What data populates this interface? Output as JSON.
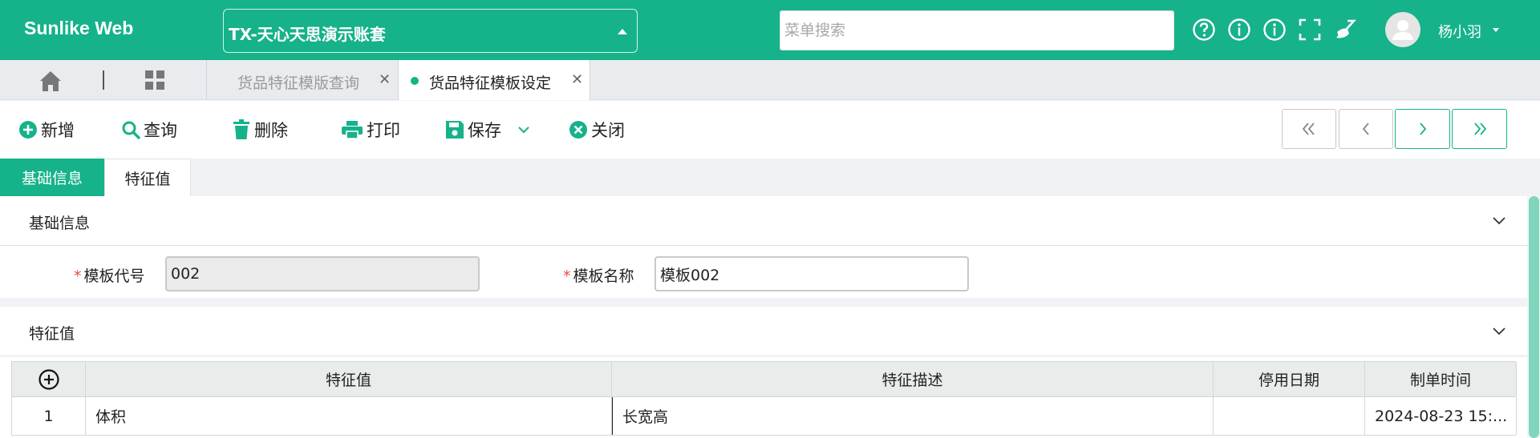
{
  "header": {
    "brand": "Sunlike Web",
    "account_name": "TX-天心天思演示账套",
    "search_placeholder": "菜单搜索",
    "user_name": "杨小羽",
    "icons": [
      "help-icon",
      "info-icon",
      "about-icon",
      "fullscreen-icon",
      "clean-cache-icon"
    ],
    "accent_color": "#16b28a"
  },
  "tabs": [
    {
      "label": "货品特征模版查询",
      "active": false
    },
    {
      "label": "货品特征模板设定",
      "active": true
    }
  ],
  "toolbar": {
    "add": "新增",
    "query": "查询",
    "delete": "删除",
    "print": "打印",
    "save": "保存",
    "close": "关闭"
  },
  "section_tabs": [
    "基础信息",
    "特征值"
  ],
  "basic_info": {
    "title": "基础信息",
    "code_label": "模板代号",
    "code_value": "002",
    "name_label": "模板名称",
    "name_value": "模板002"
  },
  "features": {
    "title": "特征值",
    "columns": [
      "特征值",
      "特征描述",
      "停用日期",
      "制单时间"
    ],
    "rows": [
      {
        "index": "1",
        "value": "体积",
        "description": "长宽高",
        "stop_date": "",
        "created": "2024-08-23 15:..."
      }
    ]
  }
}
